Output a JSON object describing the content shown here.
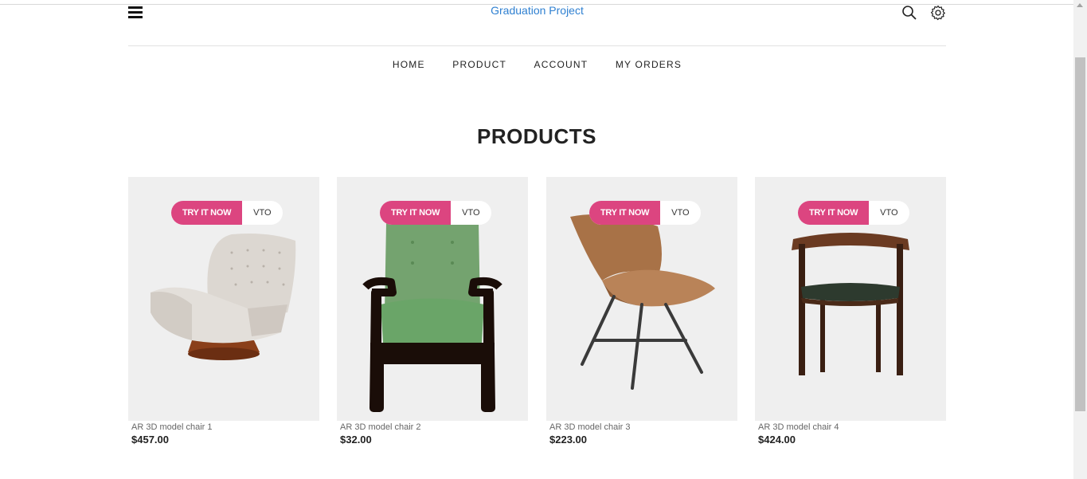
{
  "header": {
    "brand": "Graduation Project"
  },
  "nav": {
    "items": [
      "HOME",
      "PRODUCT",
      "ACCOUNT",
      "MY ORDERS"
    ]
  },
  "section": {
    "title": "PRODUCTS"
  },
  "products": [
    {
      "name": "AR 3D model chair 1",
      "price": "$457.00",
      "try_label": "TRY IT NOW",
      "vto_label": "VTO"
    },
    {
      "name": "AR 3D model chair 2",
      "price": "$32.00",
      "try_label": "TRY IT NOW",
      "vto_label": "VTO"
    },
    {
      "name": "AR 3D model chair 3",
      "price": "$223.00",
      "try_label": "TRY IT NOW",
      "vto_label": "VTO"
    },
    {
      "name": "AR 3D model chair 4",
      "price": "$424.00",
      "try_label": "TRY IT NOW",
      "vto_label": "VTO"
    }
  ],
  "colors": {
    "accent": "#dc4580",
    "brand": "#2f80d1",
    "underline": "#eaa4bf",
    "card_bg": "#efefef"
  },
  "icons": [
    "menu-icon",
    "search-icon",
    "gear-icon"
  ]
}
